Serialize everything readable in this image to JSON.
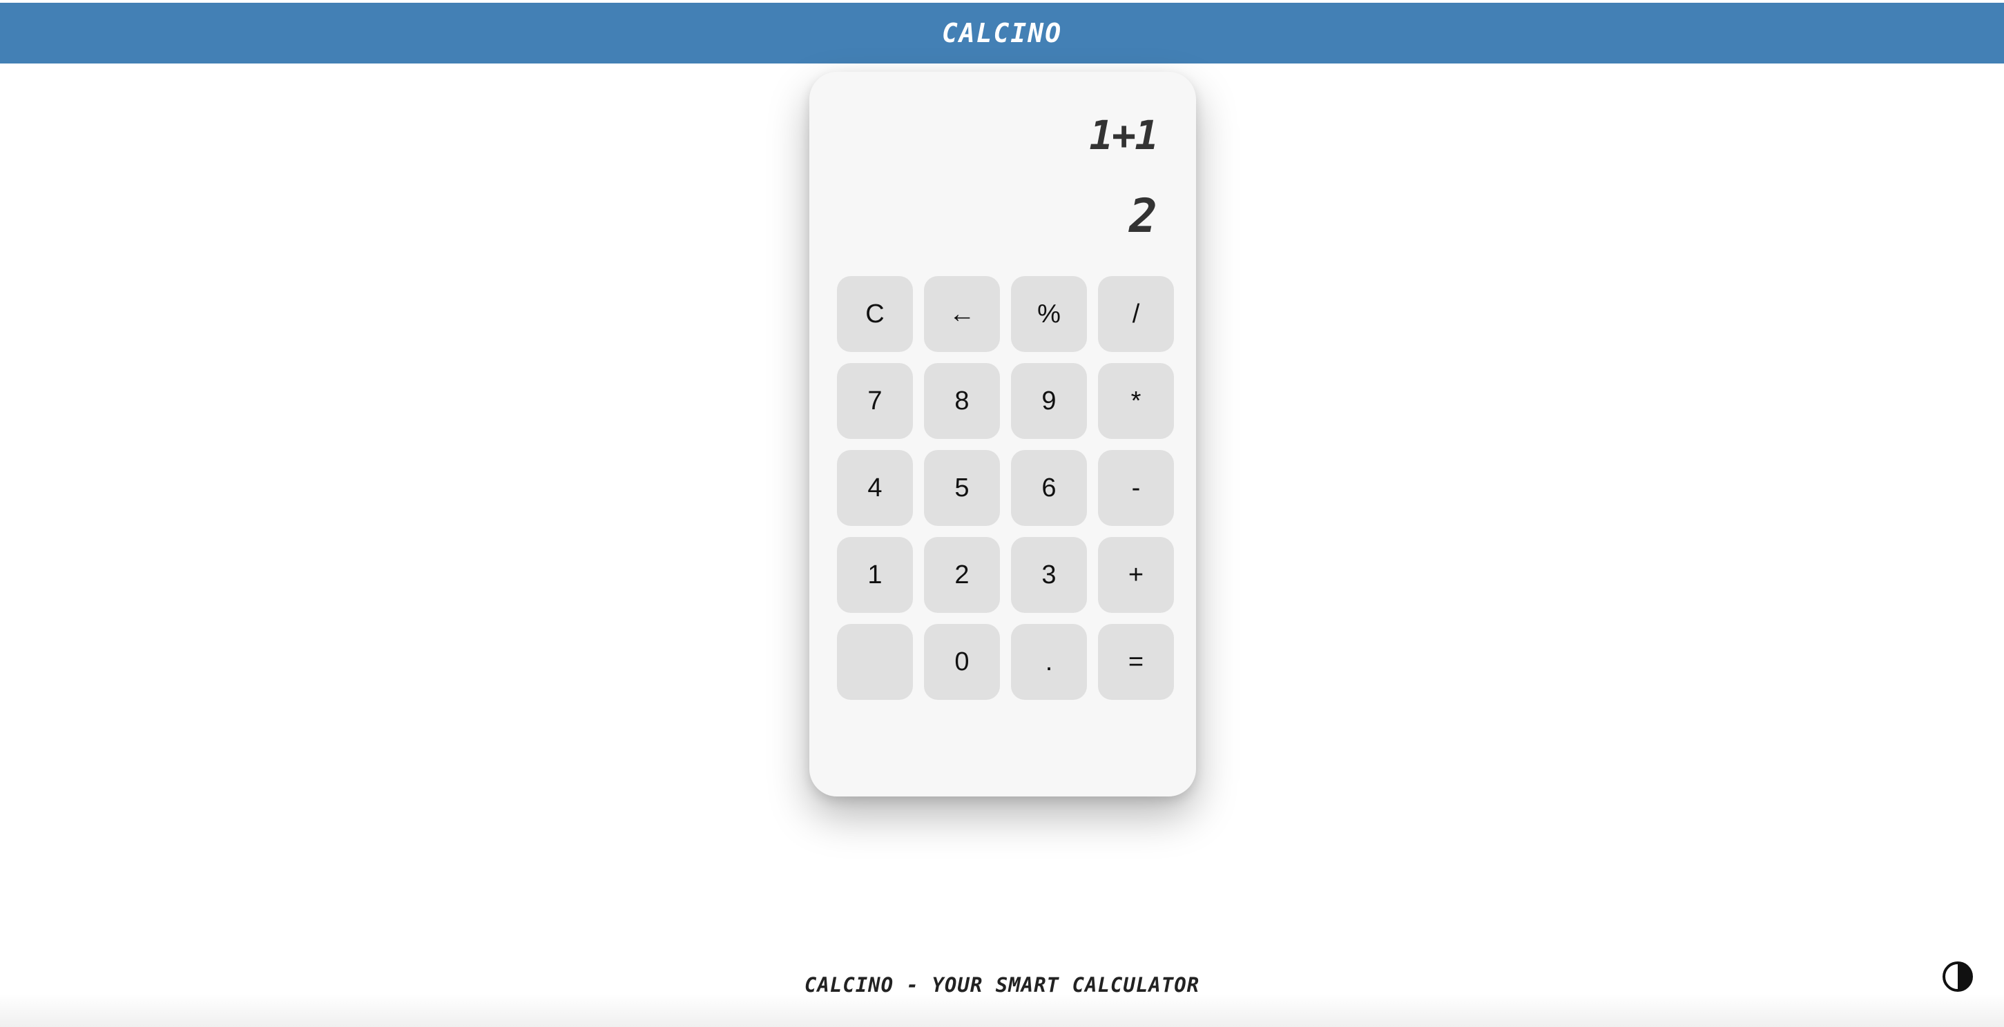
{
  "header": {
    "title": "CALCINO"
  },
  "display": {
    "expression": "1+1",
    "result": "2"
  },
  "keypad": {
    "rows": [
      [
        "C",
        "←",
        "%",
        "/"
      ],
      [
        "7",
        "8",
        "9",
        "*"
      ],
      [
        "4",
        "5",
        "6",
        "-"
      ],
      [
        "1",
        "2",
        "3",
        "+"
      ],
      [
        "",
        "0",
        ".",
        "="
      ]
    ]
  },
  "footer": {
    "text": "CALCINO - YOUR SMART CALCULATOR"
  },
  "theme_toggle": {
    "icon": "half-circle-contrast-icon"
  },
  "colors": {
    "header_bg": "#4380b5",
    "key_bg": "#e0e0e0",
    "calc_bg": "#f7f7f7"
  }
}
